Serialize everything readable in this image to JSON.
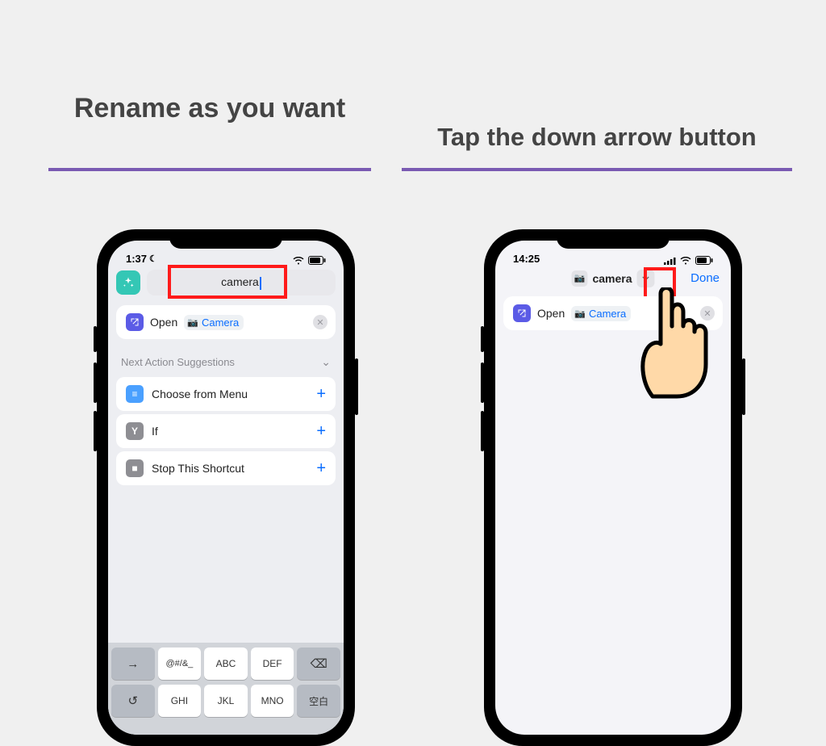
{
  "captions": {
    "left": "Rename as you want",
    "right": "Tap the down arrow button"
  },
  "colors": {
    "underline": "#7a5ab2",
    "highlight_box": "#ff1a1a",
    "link": "#0a6dff"
  },
  "phone_left": {
    "status": {
      "time": "1:37",
      "dnd": true
    },
    "title_input_value": "camera",
    "action": {
      "verb": "Open",
      "app_chip": "Camera",
      "icon": "camera-icon"
    },
    "suggestions_header": "Next Action Suggestions",
    "suggestions": [
      {
        "label": "Choose from Menu",
        "icon_bg": "#4aa0ff",
        "glyph": "≡"
      },
      {
        "label": "If",
        "icon_bg": "#8e8e93",
        "glyph": "⌥"
      },
      {
        "label": "Stop This Shortcut",
        "icon_bg": "#8e8e93",
        "glyph": "■"
      }
    ],
    "keyboard": {
      "row1": [
        "→",
        "@#/&_",
        "ABC",
        "DEF",
        "⌫"
      ],
      "row2": [
        "↺",
        "GHI",
        "JKL",
        "MNO",
        "空白"
      ]
    }
  },
  "phone_right": {
    "status": {
      "time": "14:25"
    },
    "title": "camera",
    "done_label": "Done",
    "action": {
      "verb": "Open",
      "app_chip": "Camera",
      "icon": "camera-icon"
    }
  }
}
